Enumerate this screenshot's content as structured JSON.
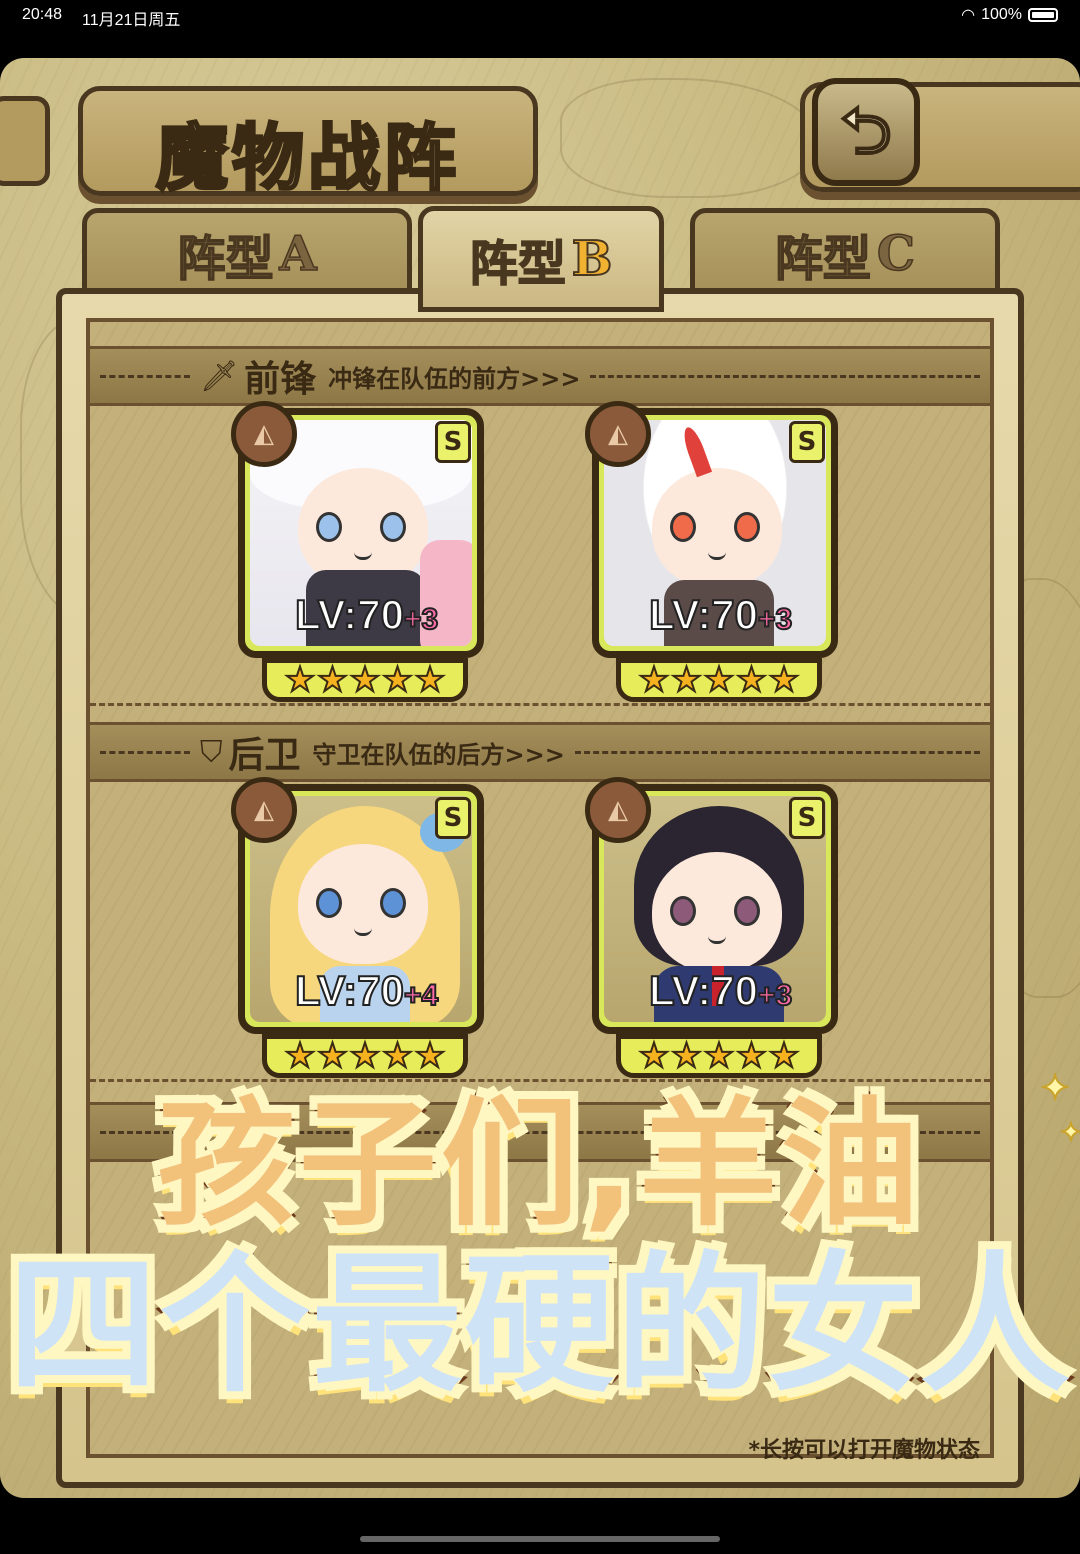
{
  "status_bar": {
    "time": "20:48",
    "date": "11月21日周五",
    "battery": "100%"
  },
  "header": {
    "title": "魔物战阵",
    "back_icon": "back-arrow-icon"
  },
  "tabs": [
    {
      "prefix": "阵型",
      "suffix": "A",
      "active": false
    },
    {
      "prefix": "阵型",
      "suffix": "B",
      "active": true
    },
    {
      "prefix": "阵型",
      "suffix": "C",
      "active": false
    }
  ],
  "sections": {
    "front": {
      "name": "前锋",
      "desc": "冲锋在队伍的前方>>>",
      "icon": "sword-icon"
    },
    "rear": {
      "name": "后卫",
      "desc": "守卫在队伍的后方>>>",
      "icon": "shield-icon"
    }
  },
  "units": [
    {
      "lv": "LV:70",
      "bonus": "+3",
      "rank": "S",
      "stars": 5
    },
    {
      "lv": "LV:70",
      "bonus": "+3",
      "rank": "S",
      "stars": 5
    },
    {
      "lv": "LV:70",
      "bonus": "+4",
      "rank": "S",
      "stars": 5
    },
    {
      "lv": "LV:70",
      "bonus": "+3",
      "rank": "S",
      "stars": 5
    }
  ],
  "footnote": "*长按可以打开魔物状态",
  "caption": {
    "line1": "孩子们,羊油",
    "line2": "四个最硬的女人"
  },
  "colors": {
    "card_border": "#d9e85a",
    "star": "#f6b21e",
    "bonus": "#ff6aa8"
  }
}
